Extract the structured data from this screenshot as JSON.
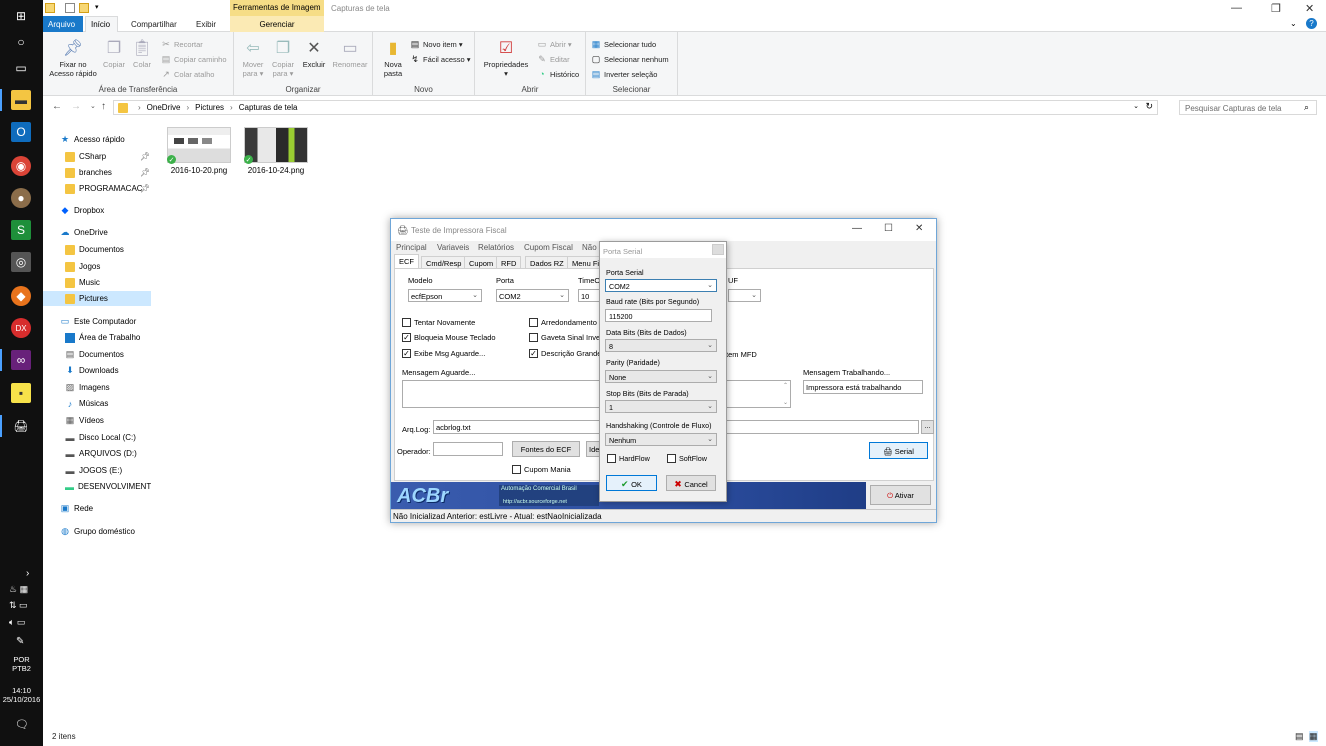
{
  "taskbar": {
    "language_1": "POR",
    "language_2": "PTB2",
    "time": "14:10",
    "date": "25/10/2016"
  },
  "titlebar": {
    "context_header": "Ferramentas de Imagem",
    "window_title": "Capturas de tela"
  },
  "ribbon_tabs": {
    "arquivo": "Arquivo",
    "inicio": "Início",
    "compartilhar": "Compartilhar",
    "exibir": "Exibir",
    "gerenciar": "Gerenciar"
  },
  "ribbon": {
    "clipboard": {
      "label": "Área de Transferência",
      "pin_1": "Fixar no",
      "pin_2": "Acesso rápido",
      "copy": "Copiar",
      "paste": "Colar",
      "cut": "Recortar",
      "copy_path": "Copiar caminho",
      "paste_shortcut": "Colar atalho"
    },
    "organize": {
      "label": "Organizar",
      "move_1": "Mover",
      "move_2": "para ▾",
      "copy_1": "Copiar",
      "copy_2": "para ▾",
      "delete": "Excluir",
      "rename": "Renomear"
    },
    "new": {
      "label": "Novo",
      "folder_1": "Nova",
      "folder_2": "pasta",
      "new_item": "Novo item ▾",
      "easy_access": "Fácil acesso ▾"
    },
    "open": {
      "label": "Abrir",
      "properties": "Propriedades",
      "open": "Abrir ▾",
      "edit": "Editar",
      "history": "Histórico"
    },
    "select": {
      "label": "Selecionar",
      "all": "Selecionar tudo",
      "none": "Selecionar nenhum",
      "invert": "Inverter seleção"
    }
  },
  "address": {
    "crumb_1": "OneDrive",
    "crumb_2": "Pictures",
    "crumb_3": "Capturas de tela",
    "search_placeholder": "Pesquisar Capturas de tela"
  },
  "nav": {
    "quick_access": "Acesso rápido",
    "csharp": "CSharp",
    "branches": "branches",
    "programacao": "PROGRAMACAC",
    "dropbox": "Dropbox",
    "onedrive": "OneDrive",
    "documentos": "Documentos",
    "jogos": "Jogos",
    "music": "Music",
    "pictures": "Pictures",
    "este_computador": "Este Computador",
    "area_trabalho": "Área de Trabalho",
    "documentos2": "Documentos",
    "downloads": "Downloads",
    "imagens": "Imagens",
    "musicas": "Músicas",
    "videos": "Vídeos",
    "disco_c": "Disco Local (C:)",
    "arquivos_d": "ARQUIVOS (D:)",
    "jogos_e": "JOGOS (E:)",
    "desenvolvimento": "DESENVOLVIMENTC",
    "rede": "Rede",
    "grupo": "Grupo doméstico"
  },
  "files": [
    {
      "name": "2016-10-20.png"
    },
    {
      "name": "2016-10-24.png"
    }
  ],
  "status": {
    "count": "2 itens"
  },
  "app": {
    "title": "Teste de Impressora Fiscal",
    "menu": [
      "Principal",
      "Variaveis",
      "Relatórios",
      "Cupom Fiscal",
      "Não"
    ],
    "tabs": [
      "ECF",
      "Cmd/Resp",
      "Cupom",
      "RFD",
      "Dados RZ",
      "Menu Fis"
    ],
    "modelo_label": "Modelo",
    "modelo_value": "ecfEpson",
    "porta_label": "Porta",
    "porta_value": "COM2",
    "timeout_label": "TimeOu",
    "timeout_value": "10",
    "uf_label": "UF",
    "chk_tentar": "Tentar Novamente",
    "chk_bloqueia": "Bloqueia Mouse Teclado",
    "chk_exibe": "Exibe Msg Aguarde...",
    "chk_arredondamento": "Arredondamento p",
    "chk_gaveta": "Gaveta Sinal Inver",
    "chk_descricao": "Descrição Grande",
    "chk_item_mfd": "tem MFD",
    "msg_aguarde_label": "Mensagem Aguarde...",
    "msg_trab_label": "Mensagem Trabalhando...",
    "msg_trab_value": "Impressora está trabalhando",
    "arqlog_label": "Arq.Log:",
    "arqlog_value": "acbrlog.txt",
    "browse": "...",
    "operador_label": "Operador:",
    "fontes_btn": "Fontes do ECF",
    "iden_btn": "Iden",
    "cupom_mania": "Cupom Mania",
    "serial_btn": "Serial",
    "ativar_btn": "Ativar",
    "banner_logo": "ACBr",
    "banner_text": "Automação Comercial Brasil",
    "banner_url": "http://acbr.sourceforge.net",
    "status_text": "Não Inicializad  Anterior: estLivre - Atual: estNaoInicializada"
  },
  "dialog": {
    "title": "Porta Serial",
    "porta_label": "Porta Serial",
    "porta_value": "COM2",
    "baud_label": "Baud rate (Bits por Segundo)",
    "baud_value": "115200",
    "data_label": "Data Bits (Bits de Dados)",
    "data_value": "8",
    "parity_label": "Parity (Paridade)",
    "parity_value": "None",
    "stop_label": "Stop Bits (Bits de Parada)",
    "stop_value": "1",
    "hand_label": "Handshaking (Controle de Fluxo)",
    "hand_value": "Nenhum",
    "hardflow": "HardFlow",
    "softflow": "SoftFlow",
    "ok": "OK",
    "cancel": "Cancel"
  }
}
